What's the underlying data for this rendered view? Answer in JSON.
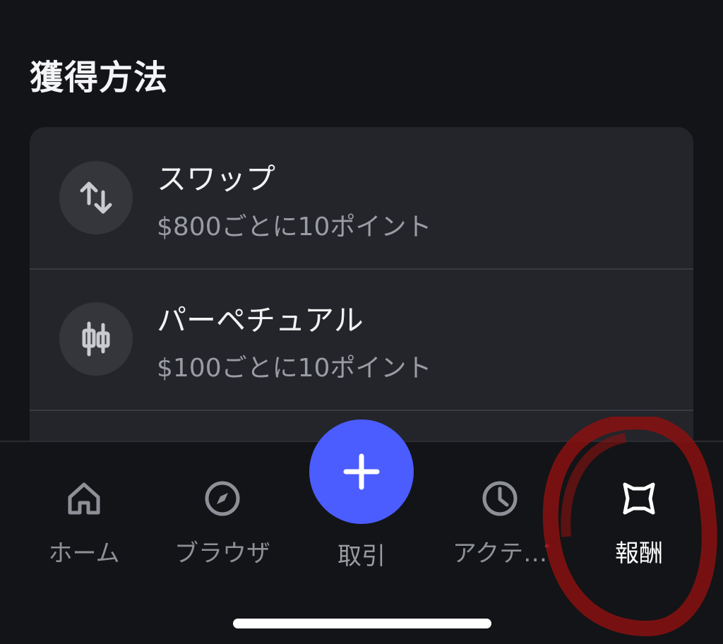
{
  "section": {
    "title": "獲得方法"
  },
  "earn_methods": [
    {
      "title": "スワップ",
      "subtitle": "$800ごとに10ポイント",
      "icon": "swap-arrows-icon"
    },
    {
      "title": "パーペチュアル",
      "subtitle": "$100ごとに10ポイント",
      "icon": "candlestick-icon"
    }
  ],
  "tabbar": {
    "tabs": [
      {
        "label": "ホーム",
        "icon": "home-icon",
        "active": false
      },
      {
        "label": "ブラウザ",
        "icon": "compass-icon",
        "active": false
      },
      {
        "label": "取引",
        "icon": "plus-icon",
        "active": false
      },
      {
        "label": "アクテ…",
        "icon": "clock-icon",
        "active": false
      },
      {
        "label": "報酬",
        "icon": "rewards-badge-icon",
        "active": true
      }
    ]
  },
  "colors": {
    "background": "#121417",
    "card": "#23252a",
    "accent": "#4b5dff",
    "annotation": "#8a1010",
    "notification_dot": "#e0475e"
  }
}
